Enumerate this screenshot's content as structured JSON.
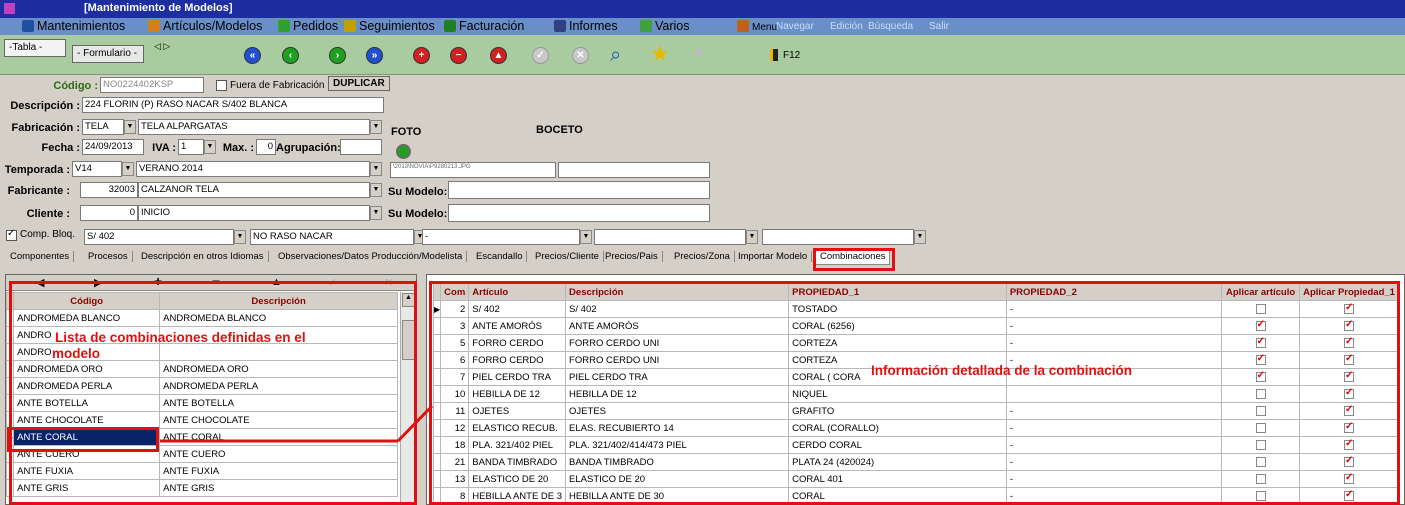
{
  "window": {
    "title": "[Mantenimiento de Modelos]"
  },
  "menu": [
    {
      "label": "Mantenimientos",
      "icon": "book-icon",
      "color": "#2050a0"
    },
    {
      "label": "Artículos/Modelos",
      "icon": "shoe-icon",
      "color": "#d08020"
    },
    {
      "label": "Pedidos",
      "icon": "cart-icon",
      "color": "#30a030"
    },
    {
      "label": "Seguimientos",
      "icon": "chart-icon",
      "color": "#c0a000"
    },
    {
      "label": "Facturación",
      "icon": "invoice-icon",
      "color": "#208020"
    },
    {
      "label": "Informes",
      "icon": "report-icon",
      "color": "#304080"
    },
    {
      "label": "Varios",
      "icon": "tools-icon",
      "color": "#40a040"
    },
    {
      "label": "Menu",
      "icon": "user-icon",
      "color": "#c06020"
    }
  ],
  "submenu": [
    "Navegar",
    "Edición",
    "Búsqueda",
    "Salir"
  ],
  "toolbar": {
    "tab_table": "-Tabla -",
    "tab_form": "- Formulario -",
    "f12": "F12"
  },
  "form": {
    "codigo_label": "Código :",
    "codigo": "NO0224402KSP",
    "fuera_label": "Fuera de Fabricación",
    "duplicar": "DUPLICAR",
    "descripcion_label": "Descripción :",
    "descripcion": "224 FLORIN (P) RASO NACAR S/402 BLANCA",
    "fabricacion_label": "Fabricación :",
    "fabricacion_code": "TELA",
    "fabricacion_desc": "TELA ALPARGATAS",
    "foto_label": "FOTO",
    "boceto_label": "BOCETO",
    "fecha_label": "Fecha :",
    "fecha": "24/09/2013",
    "iva_label": "IVA :",
    "iva": "1",
    "max_label": "Max. :",
    "max": "0",
    "agrupacion_label": "Agrupación:",
    "temporada_label": "Temporada :",
    "temporada_code": "V14",
    "temporada_desc": "VERANO 2014",
    "foto_path": "\\2013\\NOVIA\\P9280213.JPG",
    "fabricante_label": "Fabricante :",
    "fabricante_code": "32003",
    "fabricante_desc": "CALZANOR TELA",
    "sumodelo_label": "Su Modelo:",
    "cliente_label": "Cliente :",
    "cliente_code": "0",
    "cliente_desc": "INICIO",
    "sumodelo2_label": "Su Modelo:",
    "compbloq_label": "Comp. Bloq.",
    "sel1": "S/ 402",
    "sel2": "NO RASO NACAR",
    "sel3": "-"
  },
  "tabs": [
    "Componentes",
    "Procesos",
    "Descripción en otros Idiomas",
    "Observaciones/Datos Producción/Modelista",
    "Escandallo",
    "Precios/Cliente",
    "Precios/Pais",
    "Precios/Zona",
    "Importar Modelo",
    "Combinaciones"
  ],
  "left": {
    "headers": [
      "Código",
      "Descripción"
    ],
    "rows": [
      [
        "ANDROMEDA BLANCO",
        "ANDROMEDA BLANCO"
      ],
      [
        "ANDRO",
        ""
      ],
      [
        "ANDRO",
        ""
      ],
      [
        "ANDROMEDA ORO",
        "ANDROMEDA ORO"
      ],
      [
        "ANDROMEDA PERLA",
        "ANDROMEDA PERLA"
      ],
      [
        "ANTE BOTELLA",
        "ANTE BOTELLA"
      ],
      [
        "ANTE CHOCOLATE",
        "ANTE CHOCOLATE"
      ],
      [
        "ANTE CORAL",
        "ANTE CORAL"
      ],
      [
        "ANTE CUERO",
        "ANTE CUERO"
      ],
      [
        "ANTE FUXIA",
        "ANTE FUXIA"
      ],
      [
        "ANTE GRIS",
        "ANTE GRIS"
      ]
    ],
    "annotation_line1": "Lista de combinaciones definidas en el",
    "annotation_line2": "modelo"
  },
  "right": {
    "headers": [
      "Com",
      "Artículo",
      "Descripción",
      "PROPIEDAD_1",
      "PROPIEDAD_2",
      "Aplicar artículo",
      "Aplicar Propiedad_1"
    ],
    "rows": [
      {
        "n": "2",
        "art": "S/ 402",
        "desc": "S/ 402",
        "p1": "TOSTADO",
        "p2": "-",
        "a": false,
        "b": true
      },
      {
        "n": "3",
        "art": "ANTE AMORÓS",
        "desc": "ANTE AMORÓS",
        "p1": "CORAL (6256)",
        "p2": "-",
        "a": true,
        "b": true
      },
      {
        "n": "5",
        "art": "FORRO CERDO",
        "desc": "FORRO CERDO UNI",
        "p1": "CORTEZA",
        "p2": "-",
        "a": true,
        "b": true
      },
      {
        "n": "6",
        "art": "FORRO CERDO",
        "desc": "FORRO CERDO UNI",
        "p1": "CORTEZA",
        "p2": "-",
        "a": true,
        "b": true
      },
      {
        "n": "7",
        "art": "PIEL CERDO TRA",
        "desc": "PIEL CERDO TRA",
        "p1": "CORAL ( CORA",
        "p2": "",
        "a": true,
        "b": true
      },
      {
        "n": "10",
        "art": "HEBILLA DE 12",
        "desc": "HEBILLA DE 12",
        "p1": "NIQUEL",
        "p2": "",
        "a": false,
        "b": true
      },
      {
        "n": "11",
        "art": "OJETES",
        "desc": "OJETES",
        "p1": "GRAFITO",
        "p2": "-",
        "a": false,
        "b": true
      },
      {
        "n": "12",
        "art": "ELASTICO RECUB.",
        "desc": "ELAS. RECUBIERTO 14",
        "p1": "CORAL (CORALLO)",
        "p2": "-",
        "a": false,
        "b": true
      },
      {
        "n": "18",
        "art": "PLA. 321/402 PIEL",
        "desc": "PLA. 321/402/414/473 PIEL",
        "p1": "CERDO CORAL",
        "p2": "-",
        "a": false,
        "b": true
      },
      {
        "n": "21",
        "art": "BANDA TIMBRADO",
        "desc": "BANDA TIMBRADO",
        "p1": "PLATA 24 (420024)",
        "p2": "-",
        "a": false,
        "b": true
      },
      {
        "n": "13",
        "art": "ELASTICO DE 20",
        "desc": "ELASTICO DE 20",
        "p1": "CORAL 401",
        "p2": "-",
        "a": false,
        "b": true
      },
      {
        "n": "8",
        "art": "HEBILLA ANTE DE 3",
        "desc": "HEBILLA ANTE DE 30",
        "p1": "CORAL",
        "p2": "-",
        "a": false,
        "b": true
      }
    ],
    "annotation": "Información detallada de la combinación"
  }
}
